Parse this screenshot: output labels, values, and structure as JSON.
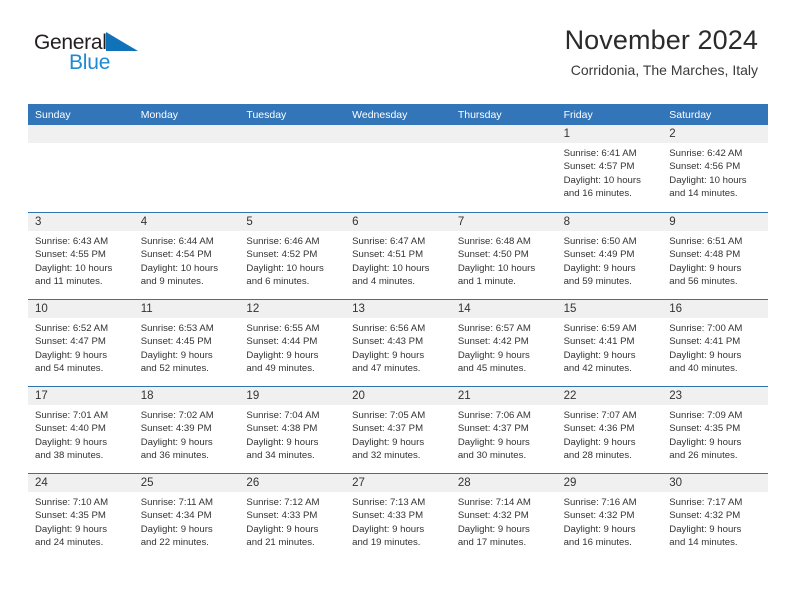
{
  "brand": {
    "word1": "General",
    "word2": "Blue",
    "triangle_color": "#1072b9",
    "blue_text_color": "#1f8ad2"
  },
  "header": {
    "title": "November 2024",
    "subtitle": "Corridonia, The Marches, Italy"
  },
  "theme": {
    "header_blue": "#3275b8",
    "row_divider_blue": "#2f73b0",
    "day_band_gray": "#f0f0f0",
    "text_color": "#333333"
  },
  "weekdays": [
    "Sunday",
    "Monday",
    "Tuesday",
    "Wednesday",
    "Thursday",
    "Friday",
    "Saturday"
  ],
  "weeks": [
    [
      {
        "day": "",
        "sunrise": "",
        "sunset": "",
        "daylight_1": "",
        "daylight_2": ""
      },
      {
        "day": "",
        "sunrise": "",
        "sunset": "",
        "daylight_1": "",
        "daylight_2": ""
      },
      {
        "day": "",
        "sunrise": "",
        "sunset": "",
        "daylight_1": "",
        "daylight_2": ""
      },
      {
        "day": "",
        "sunrise": "",
        "sunset": "",
        "daylight_1": "",
        "daylight_2": ""
      },
      {
        "day": "",
        "sunrise": "",
        "sunset": "",
        "daylight_1": "",
        "daylight_2": ""
      },
      {
        "day": "1",
        "sunrise": "Sunrise: 6:41 AM",
        "sunset": "Sunset: 4:57 PM",
        "daylight_1": "Daylight: 10 hours",
        "daylight_2": "and 16 minutes."
      },
      {
        "day": "2",
        "sunrise": "Sunrise: 6:42 AM",
        "sunset": "Sunset: 4:56 PM",
        "daylight_1": "Daylight: 10 hours",
        "daylight_2": "and 14 minutes."
      }
    ],
    [
      {
        "day": "3",
        "sunrise": "Sunrise: 6:43 AM",
        "sunset": "Sunset: 4:55 PM",
        "daylight_1": "Daylight: 10 hours",
        "daylight_2": "and 11 minutes."
      },
      {
        "day": "4",
        "sunrise": "Sunrise: 6:44 AM",
        "sunset": "Sunset: 4:54 PM",
        "daylight_1": "Daylight: 10 hours",
        "daylight_2": "and 9 minutes."
      },
      {
        "day": "5",
        "sunrise": "Sunrise: 6:46 AM",
        "sunset": "Sunset: 4:52 PM",
        "daylight_1": "Daylight: 10 hours",
        "daylight_2": "and 6 minutes."
      },
      {
        "day": "6",
        "sunrise": "Sunrise: 6:47 AM",
        "sunset": "Sunset: 4:51 PM",
        "daylight_1": "Daylight: 10 hours",
        "daylight_2": "and 4 minutes."
      },
      {
        "day": "7",
        "sunrise": "Sunrise: 6:48 AM",
        "sunset": "Sunset: 4:50 PM",
        "daylight_1": "Daylight: 10 hours",
        "daylight_2": "and 1 minute."
      },
      {
        "day": "8",
        "sunrise": "Sunrise: 6:50 AM",
        "sunset": "Sunset: 4:49 PM",
        "daylight_1": "Daylight: 9 hours",
        "daylight_2": "and 59 minutes."
      },
      {
        "day": "9",
        "sunrise": "Sunrise: 6:51 AM",
        "sunset": "Sunset: 4:48 PM",
        "daylight_1": "Daylight: 9 hours",
        "daylight_2": "and 56 minutes."
      }
    ],
    [
      {
        "day": "10",
        "sunrise": "Sunrise: 6:52 AM",
        "sunset": "Sunset: 4:47 PM",
        "daylight_1": "Daylight: 9 hours",
        "daylight_2": "and 54 minutes."
      },
      {
        "day": "11",
        "sunrise": "Sunrise: 6:53 AM",
        "sunset": "Sunset: 4:45 PM",
        "daylight_1": "Daylight: 9 hours",
        "daylight_2": "and 52 minutes."
      },
      {
        "day": "12",
        "sunrise": "Sunrise: 6:55 AM",
        "sunset": "Sunset: 4:44 PM",
        "daylight_1": "Daylight: 9 hours",
        "daylight_2": "and 49 minutes."
      },
      {
        "day": "13",
        "sunrise": "Sunrise: 6:56 AM",
        "sunset": "Sunset: 4:43 PM",
        "daylight_1": "Daylight: 9 hours",
        "daylight_2": "and 47 minutes."
      },
      {
        "day": "14",
        "sunrise": "Sunrise: 6:57 AM",
        "sunset": "Sunset: 4:42 PM",
        "daylight_1": "Daylight: 9 hours",
        "daylight_2": "and 45 minutes."
      },
      {
        "day": "15",
        "sunrise": "Sunrise: 6:59 AM",
        "sunset": "Sunset: 4:41 PM",
        "daylight_1": "Daylight: 9 hours",
        "daylight_2": "and 42 minutes."
      },
      {
        "day": "16",
        "sunrise": "Sunrise: 7:00 AM",
        "sunset": "Sunset: 4:41 PM",
        "daylight_1": "Daylight: 9 hours",
        "daylight_2": "and 40 minutes."
      }
    ],
    [
      {
        "day": "17",
        "sunrise": "Sunrise: 7:01 AM",
        "sunset": "Sunset: 4:40 PM",
        "daylight_1": "Daylight: 9 hours",
        "daylight_2": "and 38 minutes."
      },
      {
        "day": "18",
        "sunrise": "Sunrise: 7:02 AM",
        "sunset": "Sunset: 4:39 PM",
        "daylight_1": "Daylight: 9 hours",
        "daylight_2": "and 36 minutes."
      },
      {
        "day": "19",
        "sunrise": "Sunrise: 7:04 AM",
        "sunset": "Sunset: 4:38 PM",
        "daylight_1": "Daylight: 9 hours",
        "daylight_2": "and 34 minutes."
      },
      {
        "day": "20",
        "sunrise": "Sunrise: 7:05 AM",
        "sunset": "Sunset: 4:37 PM",
        "daylight_1": "Daylight: 9 hours",
        "daylight_2": "and 32 minutes."
      },
      {
        "day": "21",
        "sunrise": "Sunrise: 7:06 AM",
        "sunset": "Sunset: 4:37 PM",
        "daylight_1": "Daylight: 9 hours",
        "daylight_2": "and 30 minutes."
      },
      {
        "day": "22",
        "sunrise": "Sunrise: 7:07 AM",
        "sunset": "Sunset: 4:36 PM",
        "daylight_1": "Daylight: 9 hours",
        "daylight_2": "and 28 minutes."
      },
      {
        "day": "23",
        "sunrise": "Sunrise: 7:09 AM",
        "sunset": "Sunset: 4:35 PM",
        "daylight_1": "Daylight: 9 hours",
        "daylight_2": "and 26 minutes."
      }
    ],
    [
      {
        "day": "24",
        "sunrise": "Sunrise: 7:10 AM",
        "sunset": "Sunset: 4:35 PM",
        "daylight_1": "Daylight: 9 hours",
        "daylight_2": "and 24 minutes."
      },
      {
        "day": "25",
        "sunrise": "Sunrise: 7:11 AM",
        "sunset": "Sunset: 4:34 PM",
        "daylight_1": "Daylight: 9 hours",
        "daylight_2": "and 22 minutes."
      },
      {
        "day": "26",
        "sunrise": "Sunrise: 7:12 AM",
        "sunset": "Sunset: 4:33 PM",
        "daylight_1": "Daylight: 9 hours",
        "daylight_2": "and 21 minutes."
      },
      {
        "day": "27",
        "sunrise": "Sunrise: 7:13 AM",
        "sunset": "Sunset: 4:33 PM",
        "daylight_1": "Daylight: 9 hours",
        "daylight_2": "and 19 minutes."
      },
      {
        "day": "28",
        "sunrise": "Sunrise: 7:14 AM",
        "sunset": "Sunset: 4:32 PM",
        "daylight_1": "Daylight: 9 hours",
        "daylight_2": "and 17 minutes."
      },
      {
        "day": "29",
        "sunrise": "Sunrise: 7:16 AM",
        "sunset": "Sunset: 4:32 PM",
        "daylight_1": "Daylight: 9 hours",
        "daylight_2": "and 16 minutes."
      },
      {
        "day": "30",
        "sunrise": "Sunrise: 7:17 AM",
        "sunset": "Sunset: 4:32 PM",
        "daylight_1": "Daylight: 9 hours",
        "daylight_2": "and 14 minutes."
      }
    ]
  ]
}
